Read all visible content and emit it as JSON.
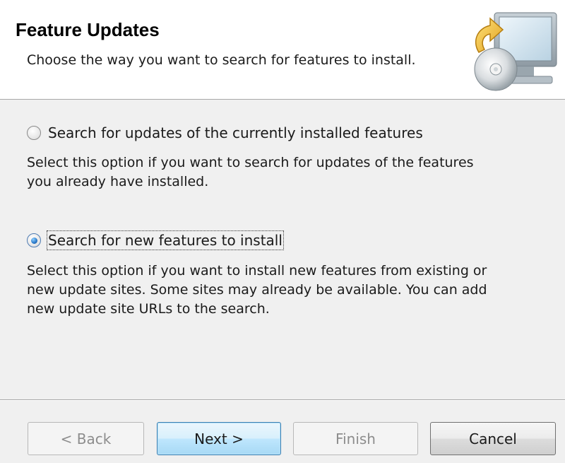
{
  "header": {
    "title": "Feature Updates",
    "subtitle": "Choose the way you want to search for features to install."
  },
  "options": [
    {
      "label": "Search for updates of the currently installed features",
      "checked": false,
      "description_lines": [
        "Select this option if you want to search for updates of the features",
        "you already have installed."
      ]
    },
    {
      "label": "Search for new features to install",
      "checked": true,
      "description_lines": [
        "Select this option if you want to install new features from existing or",
        "new update sites. Some sites may already be available. You can add",
        "new update site URLs to the search."
      ]
    }
  ],
  "buttons": {
    "back": "< Back",
    "next": "Next >",
    "finish": "Finish",
    "cancel": "Cancel"
  },
  "icons": {
    "banner": "update-computer-cd-icon",
    "radio_unchecked": "radio-unchecked-icon",
    "radio_checked": "radio-checked-icon"
  },
  "colors": {
    "header_background": "#ffffff",
    "body_background": "#f0f0f0",
    "default_button_border": "#3c7fb1",
    "radio_dot": "#2a78c8"
  }
}
